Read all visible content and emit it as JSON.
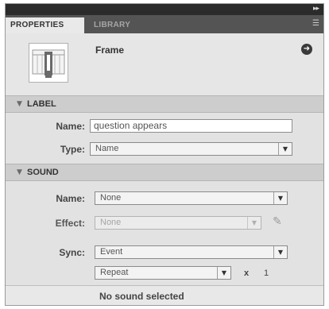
{
  "tabs": [
    {
      "label": "PROPERTIES",
      "active": true
    },
    {
      "label": "LIBRARY",
      "active": false
    }
  ],
  "header": {
    "type_label": "Frame",
    "thumb_icon": "frame-icon",
    "help_icon": "help-icon"
  },
  "label_section": {
    "title": "LABEL",
    "name_label": "Name:",
    "name_value": "question appears",
    "type_label": "Type:",
    "type_value": "Name"
  },
  "sound_section": {
    "title": "SOUND",
    "name_label": "Name:",
    "name_value": "None",
    "effect_label": "Effect:",
    "effect_value": "None",
    "sync_label": "Sync:",
    "sync_value": "Event",
    "repeat_value": "Repeat",
    "times_symbol": "x",
    "repeat_count": "1"
  },
  "status": {
    "message": "No sound selected"
  },
  "colors": {
    "panel_bg": "#dcdcdc",
    "tab_bar": "#545454",
    "title_bar": "#2b2b2b"
  }
}
